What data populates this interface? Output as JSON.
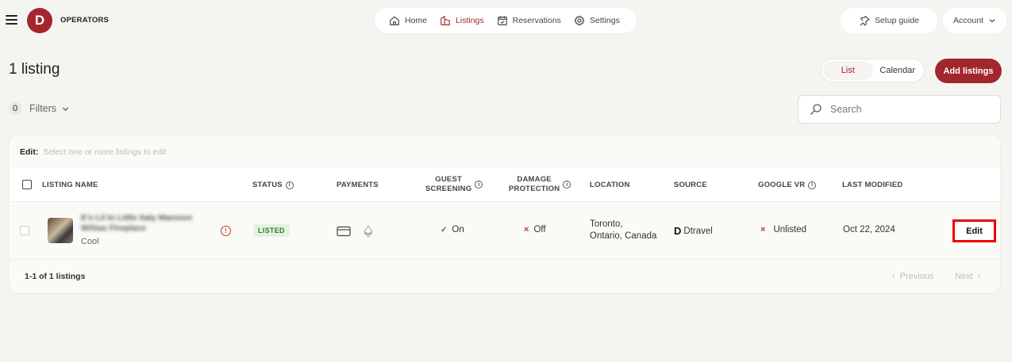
{
  "brand": {
    "logo_letter": "D",
    "name": "OPERATORS",
    "color": "#a3262f"
  },
  "nav": {
    "items": [
      {
        "label": "Home",
        "icon": "home-icon",
        "active": false
      },
      {
        "label": "Listings",
        "icon": "listings-icon",
        "active": true
      },
      {
        "label": "Reservations",
        "icon": "calendar-check-icon",
        "active": false
      },
      {
        "label": "Settings",
        "icon": "gear-icon",
        "active": false
      }
    ]
  },
  "topright": {
    "setup_label": "Setup guide",
    "account_label": "Account"
  },
  "header": {
    "title": "1 listing",
    "view_toggle": [
      "List",
      "Calendar"
    ],
    "active_view": "List",
    "add_label": "Add listings"
  },
  "filters": {
    "count": "0",
    "label": "Filters"
  },
  "search": {
    "placeholder": "Search"
  },
  "edit_bar": {
    "label": "Edit:",
    "hint": "Select one or more listings to edit"
  },
  "table": {
    "columns": {
      "name": "LISTING NAME",
      "status": "STATUS",
      "payments": "PAYMENTS",
      "guest_1": "GUEST",
      "guest_2": "SCREENING",
      "damage_1": "DAMAGE",
      "damage_2": "PROTECTION",
      "location": "LOCATION",
      "source": "SOURCE",
      "google": "GOOGLE VR",
      "modified": "LAST MODIFIED"
    },
    "rows": [
      {
        "name_line1": "E's Lil In Little Italy Mansion",
        "name_line2": "W/Gas Fireplace",
        "subname": "Cool",
        "status": "LISTED",
        "guest_screening": "On",
        "damage_protection": "Off",
        "location_line1": "Toronto,",
        "location_line2": "Ontario, Canada",
        "source": "Dtravel",
        "google_vr": "Unlisted",
        "last_modified": "Oct 22, 2024",
        "edit_label": "Edit"
      }
    ]
  },
  "footer": {
    "count": "1-1 of 1 listings",
    "previous": "Previous",
    "next": "Next"
  }
}
